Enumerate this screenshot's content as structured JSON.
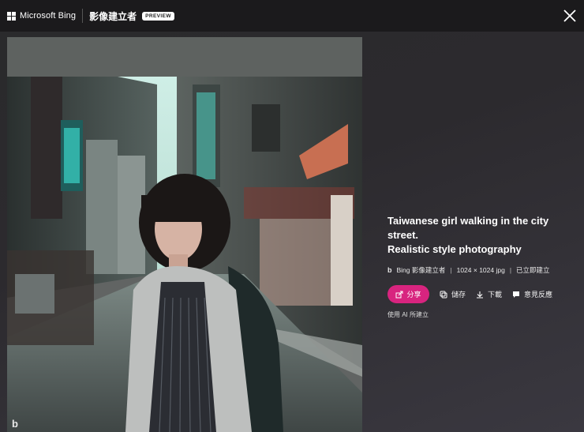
{
  "header": {
    "brand": "Microsoft Bing",
    "product": "影像建立者",
    "badge": "PREVIEW"
  },
  "image": {
    "description": "Taiwanese girl walking in the city street."
  },
  "info": {
    "title_line1": "Taiwanese girl walking in the city street.",
    "title_line2": "Realistic style photography",
    "meta": {
      "source": "Bing 影像建立者",
      "size": "1024 × 1024 jpg",
      "status": "已立即建立"
    },
    "actions": {
      "share": "分享",
      "save": "儲存",
      "download": "下載",
      "feedback": "意見反應"
    },
    "note": "使用 AI 所建立"
  },
  "colors": {
    "accent": "#d8247f",
    "topbar": "#1b1a1c"
  }
}
